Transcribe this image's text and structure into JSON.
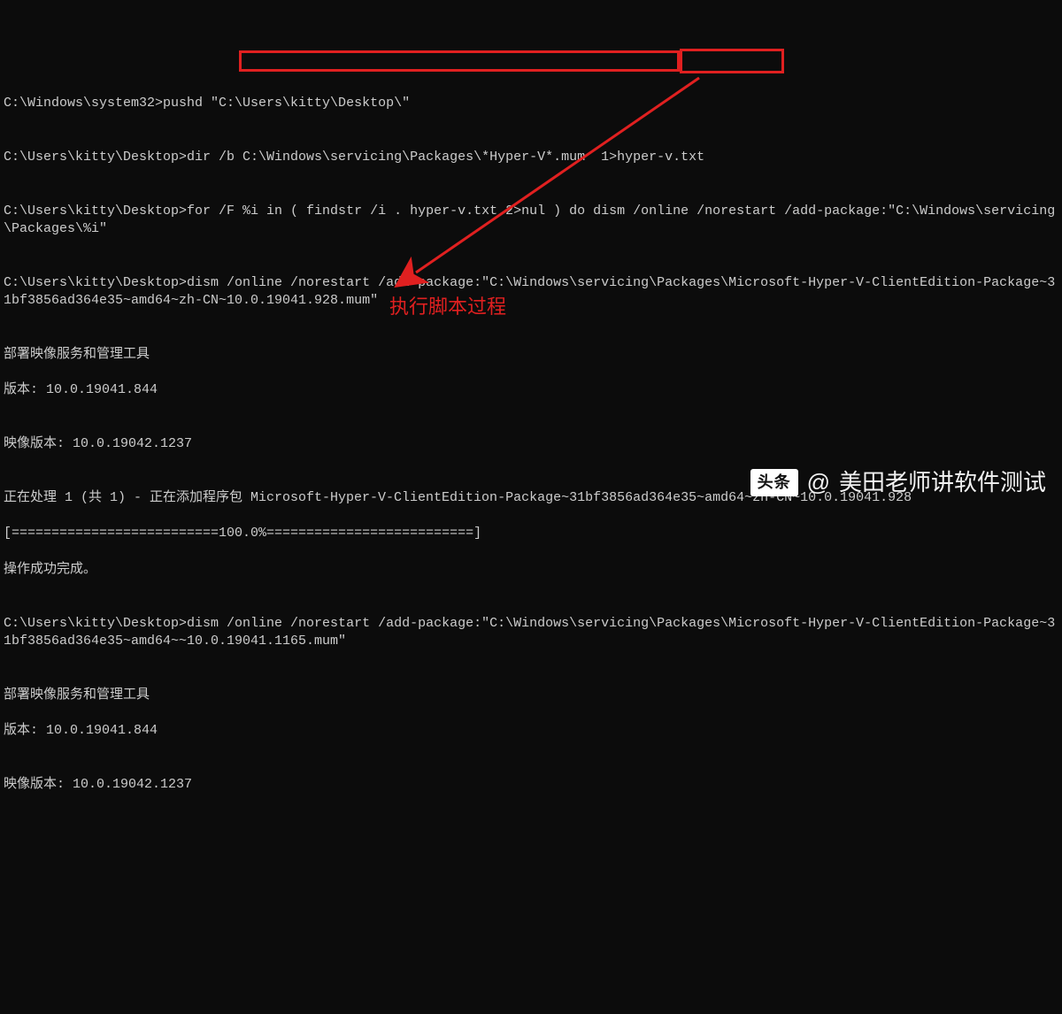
{
  "lines": {
    "l1": "C:\\Windows\\system32>pushd \"C:\\Users\\kitty\\Desktop\\\"",
    "blank1": "",
    "l2": "C:\\Users\\kitty\\Desktop>dir /b C:\\Windows\\servicing\\Packages\\*Hyper-V*.mum  1>hyper-v.txt",
    "blank2": "",
    "l3": "C:\\Users\\kitty\\Desktop>for /F %i in ( findstr /i . hyper-v.txt 2>nul ) do dism /online /norestart /add-package:\"C:\\Windows\\servicing\\Packages\\%i\"",
    "blank3": "",
    "l4": "C:\\Users\\kitty\\Desktop>dism /online /norestart /add-package:\"C:\\Windows\\servicing\\Packages\\Microsoft-Hyper-V-ClientEdition-Package~31bf3856ad364e35~amd64~zh-CN~10.0.19041.928.mum\"",
    "blank4": "",
    "l5": "部署映像服务和管理工具",
    "l6": "版本: 10.0.19041.844",
    "blank5": "",
    "l7": "映像版本: 10.0.19042.1237",
    "blank6": "",
    "l8": "正在处理 1 (共 1) - 正在添加程序包 Microsoft-Hyper-V-ClientEdition-Package~31bf3856ad364e35~amd64~zh-CN~10.0.19041.928",
    "l9": "[==========================100.0%==========================]",
    "l10": "操作成功完成。",
    "blank7": "",
    "l11": "C:\\Users\\kitty\\Desktop>dism /online /norestart /add-package:\"C:\\Windows\\servicing\\Packages\\Microsoft-Hyper-V-ClientEdition-Package~31bf3856ad364e35~amd64~~10.0.19041.1165.mum\"",
    "blank8": "",
    "l12": "部署映像服务和管理工具",
    "l13": "版本: 10.0.19041.844",
    "blank9": "",
    "l14": "映像版本: 10.0.19042.1237"
  },
  "annotation": {
    "label": "执行脚本过程"
  },
  "watermark": {
    "logo": "头条",
    "at": "@",
    "name": "美田老师讲软件测试"
  },
  "colors": {
    "bg": "#0c0c0c",
    "fg": "#cccccc",
    "highlight": "#e02020"
  }
}
